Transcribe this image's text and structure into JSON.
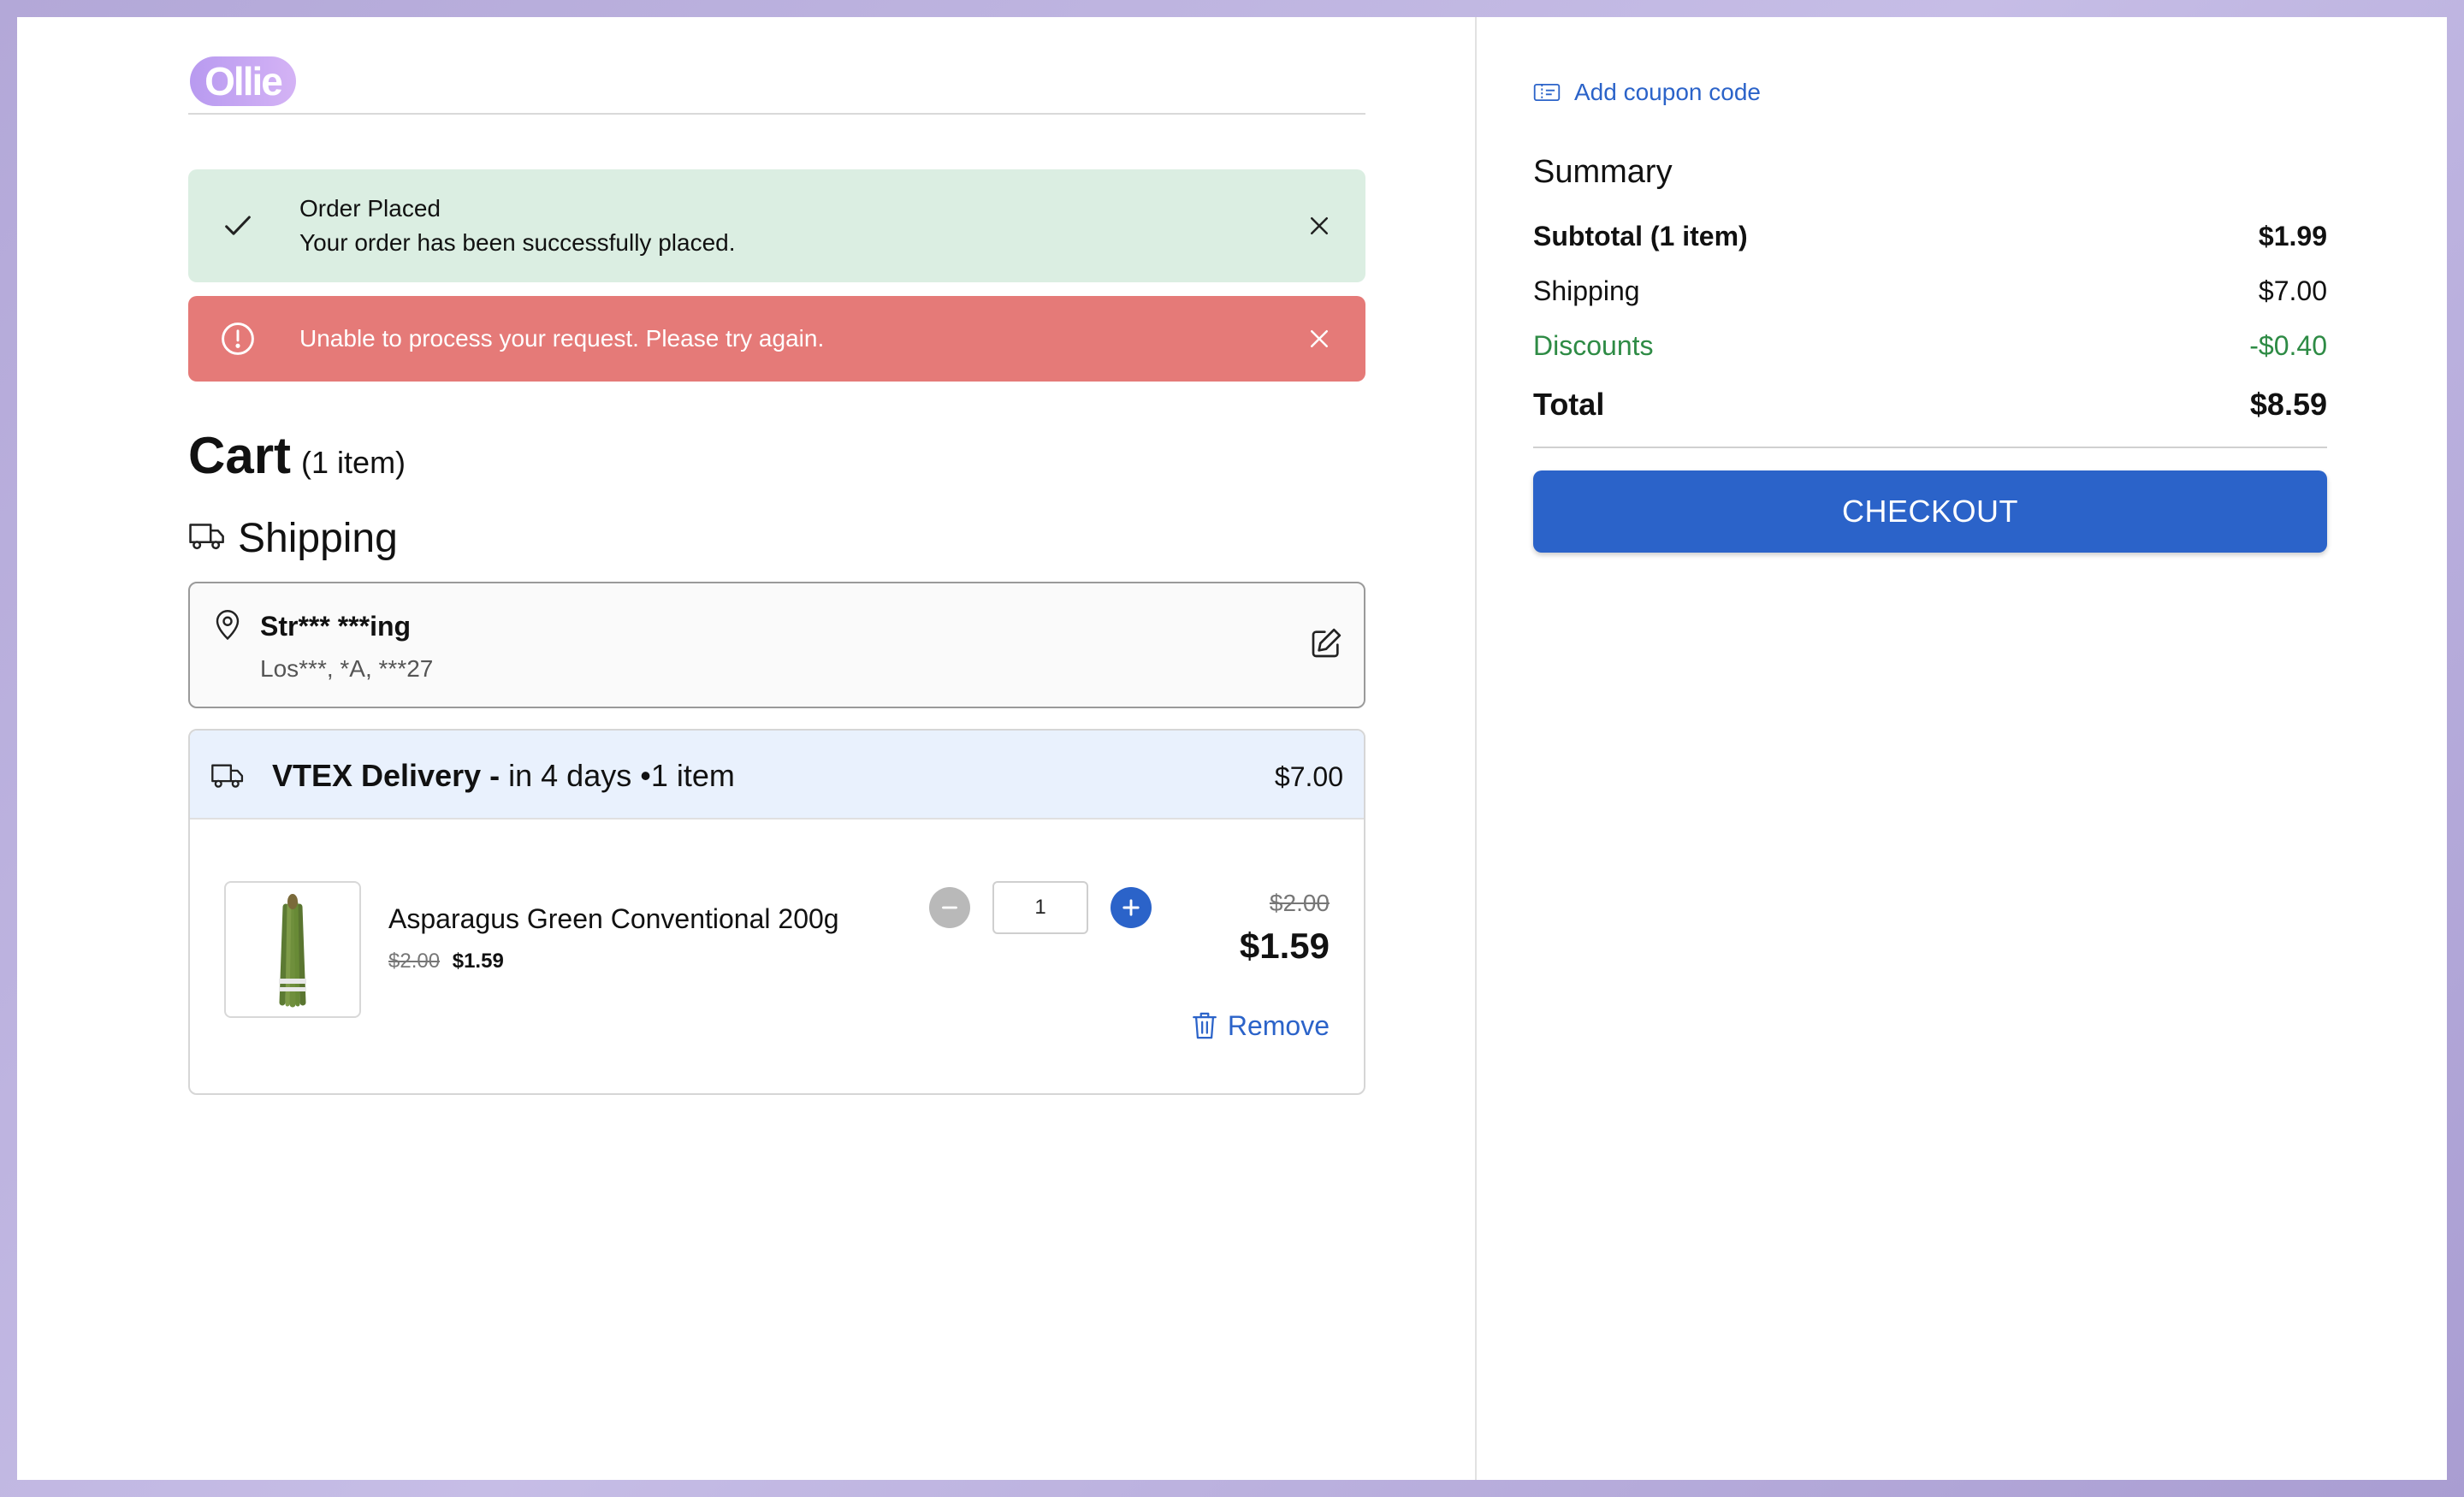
{
  "header": {
    "logo_text": "Ollie"
  },
  "alerts": {
    "success": {
      "title": "Order Placed",
      "message": "Your order has been successfully placed."
    },
    "error": {
      "message": "Unable to process your request. Please try again."
    }
  },
  "cart": {
    "title": "Cart",
    "count_label": "(1 item)"
  },
  "shipping": {
    "title": "Shipping",
    "address": {
      "street": "Str*** ***ing",
      "city": "Los***, *A, ***27"
    },
    "delivery": {
      "name": "VTEX Delivery -",
      "detail": "in 4 days •1 item",
      "price": "$7.00"
    }
  },
  "item": {
    "name": "Asparagus Green Conventional 200g",
    "unit_old_price": "$2.00",
    "unit_new_price": "$1.59",
    "quantity": "1",
    "old_price": "$2.00",
    "price": "$1.59",
    "remove_label": "Remove"
  },
  "summary": {
    "coupon_label": "Add coupon code",
    "title": "Summary",
    "subtotal_label": "Subtotal (1 item)",
    "subtotal_value": "$1.99",
    "shipping_label": "Shipping",
    "shipping_value": "$7.00",
    "discounts_label": "Discounts",
    "discounts_value": "-$0.40",
    "total_label": "Total",
    "total_value": "$8.59",
    "checkout_label": "CHECKOUT"
  },
  "colors": {
    "primary": "#2b63c9",
    "success_bg": "#dbeee2",
    "error_bg": "#e57a78",
    "discount": "#2e8b45"
  },
  "icons": [
    "check-icon",
    "close-icon",
    "alert-circle-icon",
    "truck-icon",
    "map-pin-icon",
    "edit-icon",
    "minus-icon",
    "plus-icon",
    "trash-icon",
    "ticket-icon"
  ]
}
